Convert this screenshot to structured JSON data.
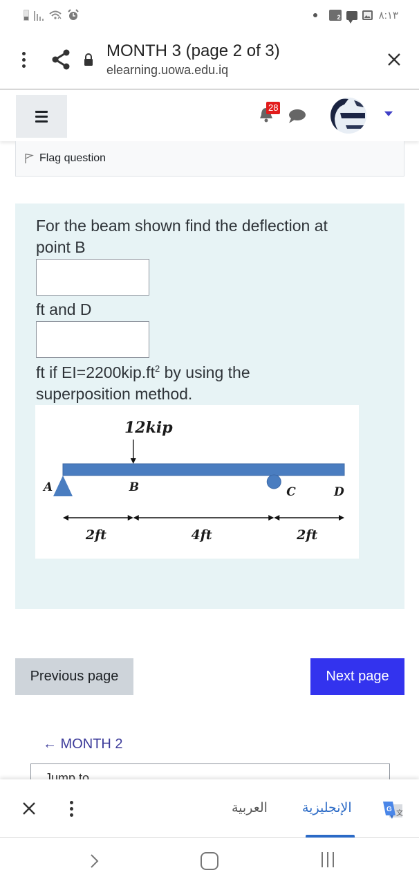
{
  "status_bar": {
    "time": "٨:١٣",
    "left_icons": [
      "battery-icon",
      "signal-icon",
      "wifi-icon",
      "alarm-icon"
    ],
    "right_icons": [
      "notification-dot-icon",
      "game-app-icon",
      "message-icon",
      "image-icon"
    ]
  },
  "custom_tab": {
    "title": "MONTH 3 (page 2 of 3)",
    "url": "elearning.uowa.edu.iq",
    "icons": [
      "more-vert-icon",
      "share-icon",
      "lock-icon",
      "close-icon"
    ]
  },
  "navbar": {
    "notification_count": "28",
    "icons": [
      "hamburger-menu-icon",
      "bell-icon",
      "chat-icon",
      "user-avatar",
      "caret-down-icon"
    ]
  },
  "flag": {
    "label": "Flag question"
  },
  "question": {
    "line1": "For the beam shown find the deflection at",
    "line2": "point B",
    "line3": "ft and D",
    "line4_pre": "ft if EI=2200kip.ft",
    "line4_sup": "2",
    "line4_post": " by using the",
    "line5": "superposition method.",
    "answer_b": {
      "value": "",
      "placeholder": ""
    },
    "answer_d": {
      "value": "",
      "placeholder": ""
    }
  },
  "diagram": {
    "load_label": "12kip",
    "points": [
      "A",
      "B",
      "C",
      "D"
    ],
    "segments": [
      {
        "from": "A",
        "to": "B",
        "length_ft": 2,
        "label": "2ft"
      },
      {
        "from": "B",
        "to": "C",
        "length_ft": 4,
        "label": "4ft"
      },
      {
        "from": "C",
        "to": "D",
        "length_ft": 2,
        "label": "2ft"
      }
    ],
    "load_at": "B",
    "supports": [
      {
        "at": "A",
        "type": "pin"
      },
      {
        "at": "C",
        "type": "roller"
      }
    ],
    "beam_color": "#4a7dc0"
  },
  "page_nav": {
    "previous_label": "Previous page",
    "next_label": "Next page",
    "previous_activity": "← MONTH 2",
    "jump_to_label": "Jump to..."
  },
  "translate_bar": {
    "lang_source": "العربية",
    "lang_target": "الإنجليزية",
    "active_lang": "الإنجليزية"
  },
  "colors": {
    "primary": "#3333ee",
    "secondary": "#ced4da",
    "question_bg": "#e7f3f5",
    "badge": "#e21b1b",
    "link": "#3c3b9a",
    "translate_accent": "#2b6ac6"
  }
}
